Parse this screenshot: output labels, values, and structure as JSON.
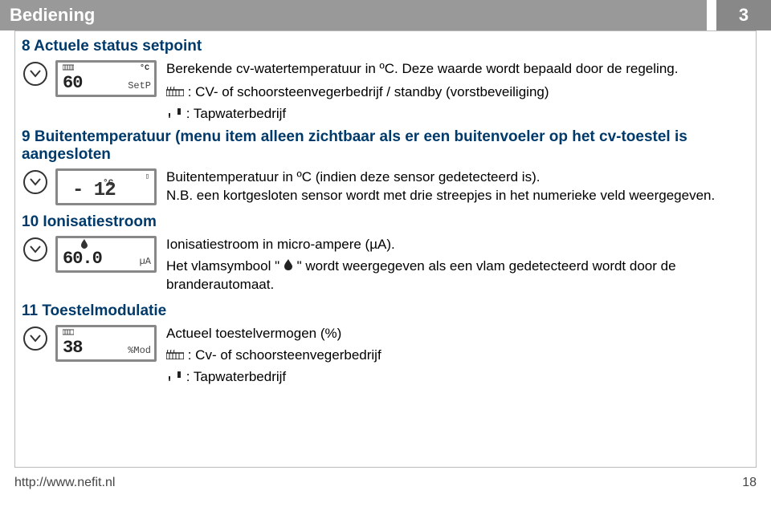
{
  "header": {
    "title": "Bediening",
    "page_badge": "3"
  },
  "sections": {
    "s8": {
      "head": "8 Actuele status setpoint",
      "lcd": {
        "big": "60",
        "suffix": "SetP",
        "degc": "°C"
      },
      "line1": "Berekende cv-watertemperatuur in ºC. Deze waarde wordt bepaald door de regeling.",
      "cv_label": ": CV- of schoorsteenvegerbedrijf / standby (vorstbeveiliging)",
      "tap_label": ": Tapwaterbedrijf"
    },
    "s9": {
      "head": "9 Buitentemperatuur (menu item alleen zichtbaar als er een buitenvoeler op het cv-toestel is aangesloten",
      "lcd": {
        "big": "- 12",
        "degc": "°C"
      },
      "line1": "Buitentemperatuur in ºC (indien deze sensor gedetecteerd is).",
      "line2": "N.B. een kortgesloten sensor wordt met drie streepjes in het numerieke veld weergegeven."
    },
    "s10": {
      "head": "10 Ionisatiestroom",
      "lcd": {
        "big": "60.0",
        "suffix": "µA"
      },
      "line1": "Ionisatiestroom in micro-ampere (µA).",
      "flame_pre": "Het vlamsymbool \"",
      "flame_post": "\" wordt weergegeven als een vlam gedetecteerd wordt door de branderautomaat."
    },
    "s11": {
      "head": "11 Toestelmodulatie",
      "lcd": {
        "big": "38",
        "suffix": "%Mod"
      },
      "line1": "Actueel toestelvermogen (%)",
      "cv_label": ": Cv- of schoorsteenvegerbedrijf",
      "tap_label": ": Tapwaterbedrijf"
    }
  },
  "footer": {
    "url": "http://www.nefit.nl",
    "page": "18"
  }
}
